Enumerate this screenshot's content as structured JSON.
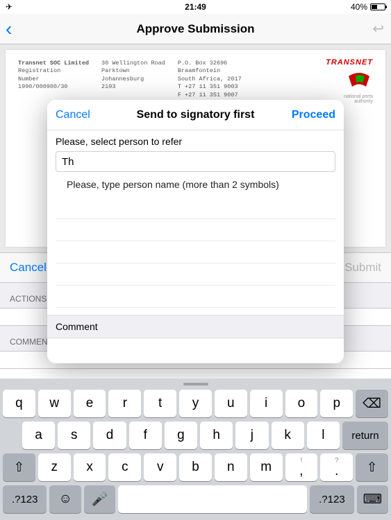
{
  "statusbar": {
    "time": "21:49",
    "battery": "40%"
  },
  "nav": {
    "title": "Approve Submission"
  },
  "document": {
    "company": "Transnet SOC Limited",
    "reg_label1": "Registration",
    "reg_label2": "Number",
    "reg_no": "1990/000900/30",
    "addr1_l1": "30 Wellington Road",
    "addr1_l2": "Parktown",
    "addr1_l3": "Johannesburg",
    "addr1_l4": "2193",
    "addr2_l1": "P.O. Box 32696",
    "addr2_l2": "Braamfontein",
    "addr2_l3": "South Africa, 2017",
    "addr2_l4": "T +27 11 351 9003",
    "addr2_l5": "F +27 11 351 9007",
    "brand": "TRANSNET",
    "brand_sub1": "national ports",
    "brand_sub2": "authority"
  },
  "under": {
    "cancel": "Cancel",
    "submit": "Submit",
    "actions": "ACTIONS",
    "comments": "COMMENTS"
  },
  "modal": {
    "cancel": "Cancel",
    "proceed": "Proceed",
    "title": "Send to signatory first",
    "select_label": "Please, select person to refer",
    "input_value": "Th",
    "hint": "Please, type person name (more than 2 symbols)",
    "comment_label": "Comment"
  },
  "keyboard": {
    "row1": [
      "q",
      "w",
      "e",
      "r",
      "t",
      "y",
      "u",
      "i",
      "o",
      "p"
    ],
    "backspace": "⌫",
    "row2": [
      "a",
      "s",
      "d",
      "f",
      "g",
      "h",
      "j",
      "k",
      "l"
    ],
    "return": "return",
    "shift": "⇧",
    "row3": [
      "z",
      "x",
      "c",
      "v",
      "b",
      "n",
      "m",
      ",",
      "."
    ],
    "q1": "!",
    "q2": "?",
    "numkey": ".?123",
    "emoji": "☺",
    "mic": "🎤",
    "kbd_icon": "⌨"
  }
}
